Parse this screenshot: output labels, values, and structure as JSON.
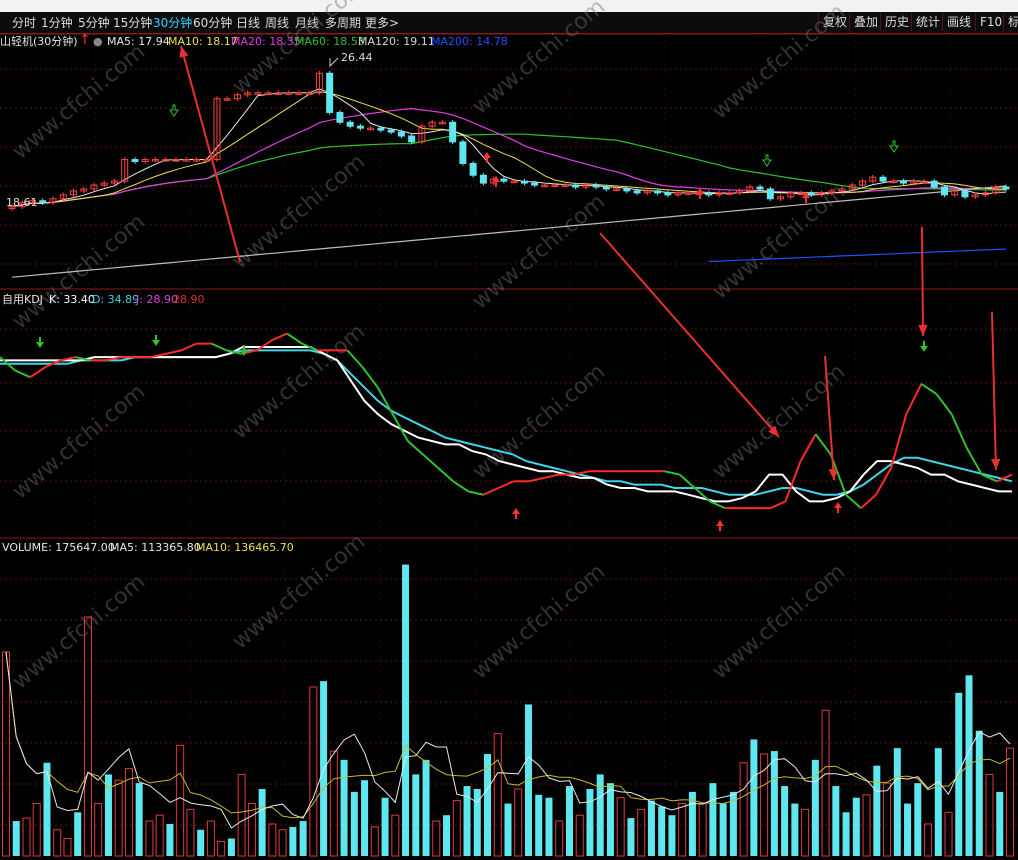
{
  "toolbar": {
    "periods": [
      "分时",
      "1分钟",
      "5分钟",
      "15分钟",
      "30分钟",
      "60分钟",
      "日线",
      "周线",
      "月线",
      "多周期",
      "更多>"
    ],
    "active_period": "30分钟",
    "tools": [
      "复权",
      "叠加",
      "历史",
      "统计",
      "画线",
      "F10",
      "标"
    ]
  },
  "price_panel": {
    "stock_name": "山轻机(30分钟)",
    "ma_labels": [
      {
        "text": "MA5: 17.94",
        "color": "#e8e8e8"
      },
      {
        "text": "MA10: 18.17",
        "color": "#f0e04a"
      },
      {
        "text": "MA20: 18.35",
        "color": "#e03ce0"
      },
      {
        "text": "MA60: 18.53",
        "color": "#2fc22f"
      },
      {
        "text": "MA120: 19.11",
        "color": "#d8d8d8"
      },
      {
        "text": "MA200: 14.78",
        "color": "#2050ff"
      }
    ],
    "high_label": "26.44",
    "low_label": "18.61"
  },
  "kdj_panel": {
    "name": "自用KDJ",
    "labels": [
      {
        "text": "K: 33.40",
        "color": "#ffffff"
      },
      {
        "text": "D: 34.89",
        "color": "#3cd6e6"
      },
      {
        "text": "J: 28.90",
        "color": "#e03ce0"
      },
      {
        "text": "28.90",
        "color": "#e03030"
      }
    ]
  },
  "volume_panel": {
    "labels": [
      {
        "text": "VOLUME: 175647.00",
        "color": "#e8e8e8"
      },
      {
        "text": "MA5: 113365.80",
        "color": "#e8e8e8"
      },
      {
        "text": "MA10: 136465.70",
        "color": "#f0e04a"
      }
    ]
  },
  "watermark": "www.cfchi.com",
  "chart_data": [
    {
      "type": "candlestick",
      "title": "山轻机(30分钟)",
      "ylim": [
        14,
        27
      ],
      "close": [
        18.2,
        18.4,
        18.5,
        18.4,
        18.6,
        18.8,
        19.0,
        19.1,
        19.3,
        19.4,
        19.5,
        20.6,
        20.5,
        20.6,
        20.6,
        20.6,
        20.6,
        20.6,
        20.6,
        20.6,
        23.7,
        23.7,
        23.9,
        24.0,
        24.0,
        24.0,
        24.0,
        24.0,
        24.0,
        24.0,
        25.0,
        23.0,
        22.5,
        22.3,
        22.2,
        22.2,
        22.1,
        22.0,
        21.8,
        21.5,
        22.3,
        22.5,
        22.5,
        21.5,
        20.4,
        19.8,
        19.4,
        19.6,
        19.5,
        19.5,
        19.4,
        19.3,
        19.3,
        19.3,
        19.3,
        19.2,
        19.3,
        19.2,
        19.1,
        19.1,
        19.0,
        18.9,
        19.0,
        18.9,
        18.8,
        18.9,
        18.9,
        18.9,
        18.8,
        18.9,
        18.9,
        19.0,
        19.2,
        19.1,
        18.6,
        18.7,
        18.9,
        18.9,
        18.8,
        18.9,
        19.0,
        19.1,
        19.3,
        19.5,
        19.7,
        19.5,
        19.5,
        19.4,
        19.5,
        19.5,
        19.2,
        18.8,
        19.0,
        18.7,
        18.8,
        18.9,
        19.2,
        19.1
      ]
    },
    {
      "type": "line",
      "title": "自用KDJ",
      "series": [
        {
          "name": "K",
          "values": [
            52,
            52,
            52,
            52,
            52,
            52,
            52,
            53,
            53,
            53,
            53,
            53,
            53,
            53,
            53,
            53,
            53,
            54,
            56,
            56,
            56,
            56,
            56,
            56,
            54,
            52,
            46,
            40,
            36,
            33,
            31,
            29,
            28,
            27,
            27,
            25,
            24,
            22,
            21,
            20,
            19,
            19,
            18,
            17,
            17,
            15,
            14,
            14,
            13,
            13,
            13,
            12,
            11,
            10,
            10,
            11,
            13,
            18,
            18,
            13,
            10,
            10,
            11,
            13,
            18,
            22,
            22,
            21,
            20,
            18,
            18,
            16,
            15,
            14,
            13,
            13,
            33.4
          ]
        },
        {
          "name": "D",
          "values": [
            51,
            51,
            51,
            51,
            51,
            51,
            52,
            52,
            52,
            52,
            53,
            53,
            53,
            53,
            53,
            53,
            53,
            54,
            55,
            55,
            55,
            55,
            55,
            55,
            54,
            52,
            48,
            44,
            40,
            37,
            35,
            33,
            31,
            29,
            28,
            27,
            26,
            25,
            24,
            22,
            21,
            20,
            19,
            18,
            17,
            16,
            16,
            15,
            15,
            15,
            14,
            14,
            14,
            13,
            12,
            12,
            12,
            13,
            14,
            14,
            13,
            12,
            12,
            13,
            15,
            18,
            21,
            23,
            23,
            22,
            21,
            20,
            19,
            18,
            17,
            16,
            34.89
          ]
        },
        {
          "name": "J",
          "values": [
            53,
            49,
            47,
            50,
            52,
            53,
            52,
            52,
            53,
            53,
            53,
            54,
            55,
            57,
            57,
            55,
            54,
            55,
            58,
            60,
            57,
            55,
            55,
            55,
            50,
            44,
            36,
            28,
            24,
            20,
            16,
            13,
            12,
            14,
            16,
            16,
            17,
            18,
            18,
            19,
            19,
            19,
            19,
            19,
            19,
            18,
            14,
            10,
            8,
            8,
            8,
            8,
            10,
            22,
            30,
            24,
            12,
            8,
            12,
            20,
            36,
            45,
            42,
            36,
            26,
            18,
            16,
            18,
            28.9
          ]
        }
      ]
    },
    {
      "type": "bar",
      "title": "VOLUME",
      "series": [
        {
          "name": "VOLUME",
          "last": 175647.0
        },
        {
          "name": "MA5",
          "last": 113365.8
        },
        {
          "name": "MA10",
          "last": 136465.7
        }
      ]
    }
  ]
}
